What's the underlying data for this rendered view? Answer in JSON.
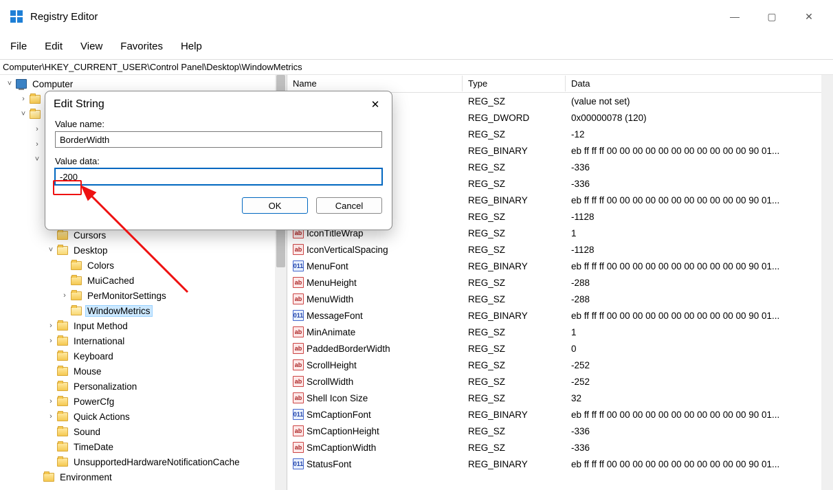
{
  "window": {
    "title": "Registry Editor",
    "controls": {
      "min": "—",
      "max": "▢",
      "close": "✕"
    }
  },
  "menu": [
    "File",
    "Edit",
    "View",
    "Favorites",
    "Help"
  ],
  "address": "Computer\\HKEY_CURRENT_USER\\Control Panel\\Desktop\\WindowMetrics",
  "tree": {
    "root": "Computer",
    "desktop_label": "Desktop",
    "cursors": "Cursors",
    "children": [
      "Colors",
      "MuiCached"
    ],
    "permonitor": "PerMonitorSettings",
    "selected": "WindowMetrics",
    "siblings": [
      "Input Method",
      "International",
      "Keyboard",
      "Mouse",
      "Personalization",
      "PowerCfg",
      "Quick Actions",
      "Sound",
      "TimeDate",
      "UnsupportedHardwareNotificationCache"
    ],
    "environment": "Environment"
  },
  "columns": {
    "name": "Name",
    "type": "Type",
    "data": "Data"
  },
  "rows": [
    {
      "name": "",
      "type": "REG_SZ",
      "data": "(value not set)",
      "icon": "sz"
    },
    {
      "name": "",
      "type": "REG_DWORD",
      "data": "0x00000078 (120)",
      "icon": "bin"
    },
    {
      "name": "",
      "type": "REG_SZ",
      "data": "-12",
      "icon": "sz"
    },
    {
      "name": "",
      "type": "REG_BINARY",
      "data": "eb ff ff ff 00 00 00 00 00 00 00 00 00 00 00 90 01...",
      "icon": "bin"
    },
    {
      "name": "",
      "type": "REG_SZ",
      "data": "-336",
      "icon": "sz"
    },
    {
      "name": "",
      "type": "REG_SZ",
      "data": "-336",
      "icon": "sz"
    },
    {
      "name": "",
      "type": "REG_BINARY",
      "data": "eb ff ff ff 00 00 00 00 00 00 00 00 00 00 00 90 01...",
      "icon": "bin"
    },
    {
      "name": "",
      "type": "REG_SZ",
      "data": "-1128",
      "icon": "sz"
    },
    {
      "name": "IconTitleWrap",
      "type": "REG_SZ",
      "data": "1",
      "icon": "sz"
    },
    {
      "name": "IconVerticalSpacing",
      "type": "REG_SZ",
      "data": "-1128",
      "icon": "sz"
    },
    {
      "name": "MenuFont",
      "type": "REG_BINARY",
      "data": "eb ff ff ff 00 00 00 00 00 00 00 00 00 00 00 90 01...",
      "icon": "bin"
    },
    {
      "name": "MenuHeight",
      "type": "REG_SZ",
      "data": "-288",
      "icon": "sz"
    },
    {
      "name": "MenuWidth",
      "type": "REG_SZ",
      "data": "-288",
      "icon": "sz"
    },
    {
      "name": "MessageFont",
      "type": "REG_BINARY",
      "data": "eb ff ff ff 00 00 00 00 00 00 00 00 00 00 00 90 01...",
      "icon": "bin"
    },
    {
      "name": "MinAnimate",
      "type": "REG_SZ",
      "data": "1",
      "icon": "sz"
    },
    {
      "name": "PaddedBorderWidth",
      "type": "REG_SZ",
      "data": "0",
      "icon": "sz"
    },
    {
      "name": "ScrollHeight",
      "type": "REG_SZ",
      "data": "-252",
      "icon": "sz"
    },
    {
      "name": "ScrollWidth",
      "type": "REG_SZ",
      "data": "-252",
      "icon": "sz"
    },
    {
      "name": "Shell Icon Size",
      "type": "REG_SZ",
      "data": "32",
      "icon": "sz"
    },
    {
      "name": "SmCaptionFont",
      "type": "REG_BINARY",
      "data": "eb ff ff ff 00 00 00 00 00 00 00 00 00 00 00 90 01...",
      "icon": "bin"
    },
    {
      "name": "SmCaptionHeight",
      "type": "REG_SZ",
      "data": "-336",
      "icon": "sz"
    },
    {
      "name": "SmCaptionWidth",
      "type": "REG_SZ",
      "data": "-336",
      "icon": "sz"
    },
    {
      "name": "StatusFont",
      "type": "REG_BINARY",
      "data": "eb ff ff ff 00 00 00 00 00 00 00 00 00 00 00 90 01...",
      "icon": "bin"
    }
  ],
  "dialog": {
    "title": "Edit String",
    "value_name_label": "Value name:",
    "value_name": "BorderWidth",
    "value_data_label": "Value data:",
    "value_data": "-200",
    "ok": "OK",
    "cancel": "Cancel"
  },
  "icon_labels": {
    "sz": "ab",
    "bin": "011"
  }
}
